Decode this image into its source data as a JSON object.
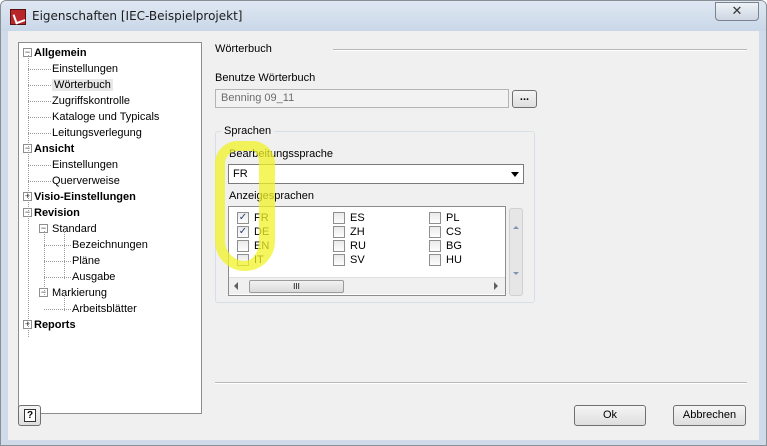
{
  "window": {
    "title": "Eigenschaften [IEC-Beispielprojekt]",
    "close_glyph": "✕"
  },
  "tree": [
    {
      "label": "Allgemein",
      "bold": true,
      "level": 0,
      "expander": "−"
    },
    {
      "label": "Einstellungen",
      "level": 1
    },
    {
      "label": "Wörterbuch",
      "level": 1,
      "selected": true
    },
    {
      "label": "Zugriffskontrolle",
      "level": 1
    },
    {
      "label": "Kataloge und Typicals",
      "level": 1
    },
    {
      "label": "Leitungsverlegung",
      "level": 1
    },
    {
      "label": "Ansicht",
      "bold": true,
      "level": 0,
      "expander": "−"
    },
    {
      "label": "Einstellungen",
      "level": 1
    },
    {
      "label": "Querverweise",
      "level": 1
    },
    {
      "label": "Visio-Einstellungen",
      "bold": true,
      "level": 0,
      "expander": "+"
    },
    {
      "label": "Revision",
      "bold": true,
      "level": 0,
      "expander": "−"
    },
    {
      "label": "Standard",
      "level": 1,
      "expander": "−"
    },
    {
      "label": "Bezeichnungen",
      "level": 2
    },
    {
      "label": "Pläne",
      "level": 2
    },
    {
      "label": "Ausgabe",
      "level": 2
    },
    {
      "label": "Markierung",
      "level": 1,
      "expander": "−"
    },
    {
      "label": "Arbeitsblätter",
      "level": 2
    },
    {
      "label": "Reports",
      "bold": true,
      "level": 0,
      "expander": "+"
    }
  ],
  "panel": {
    "section_title": "Wörterbuch",
    "dictionary_label": "Benutze Wörterbuch",
    "dictionary_value": "Benning 09_11",
    "browse_label": "...",
    "group_title": "Sprachen",
    "edit_lang_label": "Bearbeitungssprache",
    "edit_lang_value": "FR",
    "display_lang_label": "Anzeigesprachen",
    "languages": [
      {
        "code": "FR",
        "checked": true
      },
      {
        "code": "DE",
        "checked": true
      },
      {
        "code": "EN",
        "checked": false
      },
      {
        "code": "IT",
        "checked": false
      },
      {
        "code": "ES",
        "checked": false
      },
      {
        "code": "ZH",
        "checked": false
      },
      {
        "code": "RU",
        "checked": false
      },
      {
        "code": "SV",
        "checked": false
      },
      {
        "code": "PL",
        "checked": false
      },
      {
        "code": "CS",
        "checked": false
      },
      {
        "code": "BG",
        "checked": false
      },
      {
        "code": "HU",
        "checked": false
      }
    ],
    "scroll_thumb_glyph": "III"
  },
  "footer": {
    "help_glyph": "?",
    "ok_label": "Ok",
    "cancel_label": "Abbrechen"
  },
  "colors": {
    "highlight": "#f2f228",
    "frame": "#cfdbe9"
  }
}
